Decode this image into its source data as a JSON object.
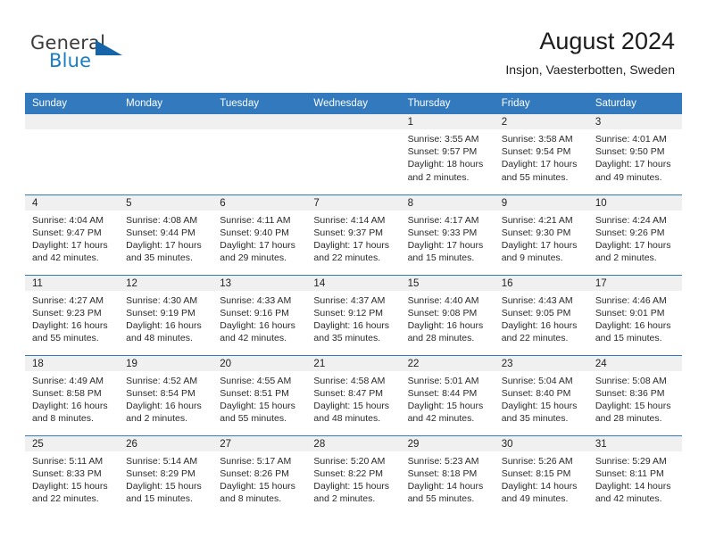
{
  "brand": {
    "name_part1": "General",
    "name_part2": "Blue",
    "triangle_color": "#1565a8",
    "blue_color": "#1a7dc4"
  },
  "header": {
    "title": "August 2024",
    "subtitle": "Insjon, Vaesterbotten, Sweden"
  },
  "theme": {
    "header_blue": "#3279bd",
    "band_gray": "#f0f0f0",
    "text": "#222222"
  },
  "weekdays": [
    "Sunday",
    "Monday",
    "Tuesday",
    "Wednesday",
    "Thursday",
    "Friday",
    "Saturday"
  ],
  "labels": {
    "sunrise_prefix": "Sunrise:",
    "sunset_prefix": "Sunset:",
    "daylight_prefix": "Daylight:"
  },
  "weeks": [
    [
      {
        "day": "",
        "sunrise": "",
        "sunset": "",
        "daylight": ""
      },
      {
        "day": "",
        "sunrise": "",
        "sunset": "",
        "daylight": ""
      },
      {
        "day": "",
        "sunrise": "",
        "sunset": "",
        "daylight": ""
      },
      {
        "day": "",
        "sunrise": "",
        "sunset": "",
        "daylight": ""
      },
      {
        "day": "1",
        "sunrise": "Sunrise: 3:55 AM",
        "sunset": "Sunset: 9:57 PM",
        "daylight": "Daylight: 18 hours and 2 minutes."
      },
      {
        "day": "2",
        "sunrise": "Sunrise: 3:58 AM",
        "sunset": "Sunset: 9:54 PM",
        "daylight": "Daylight: 17 hours and 55 minutes."
      },
      {
        "day": "3",
        "sunrise": "Sunrise: 4:01 AM",
        "sunset": "Sunset: 9:50 PM",
        "daylight": "Daylight: 17 hours and 49 minutes."
      }
    ],
    [
      {
        "day": "4",
        "sunrise": "Sunrise: 4:04 AM",
        "sunset": "Sunset: 9:47 PM",
        "daylight": "Daylight: 17 hours and 42 minutes."
      },
      {
        "day": "5",
        "sunrise": "Sunrise: 4:08 AM",
        "sunset": "Sunset: 9:44 PM",
        "daylight": "Daylight: 17 hours and 35 minutes."
      },
      {
        "day": "6",
        "sunrise": "Sunrise: 4:11 AM",
        "sunset": "Sunset: 9:40 PM",
        "daylight": "Daylight: 17 hours and 29 minutes."
      },
      {
        "day": "7",
        "sunrise": "Sunrise: 4:14 AM",
        "sunset": "Sunset: 9:37 PM",
        "daylight": "Daylight: 17 hours and 22 minutes."
      },
      {
        "day": "8",
        "sunrise": "Sunrise: 4:17 AM",
        "sunset": "Sunset: 9:33 PM",
        "daylight": "Daylight: 17 hours and 15 minutes."
      },
      {
        "day": "9",
        "sunrise": "Sunrise: 4:21 AM",
        "sunset": "Sunset: 9:30 PM",
        "daylight": "Daylight: 17 hours and 9 minutes."
      },
      {
        "day": "10",
        "sunrise": "Sunrise: 4:24 AM",
        "sunset": "Sunset: 9:26 PM",
        "daylight": "Daylight: 17 hours and 2 minutes."
      }
    ],
    [
      {
        "day": "11",
        "sunrise": "Sunrise: 4:27 AM",
        "sunset": "Sunset: 9:23 PM",
        "daylight": "Daylight: 16 hours and 55 minutes."
      },
      {
        "day": "12",
        "sunrise": "Sunrise: 4:30 AM",
        "sunset": "Sunset: 9:19 PM",
        "daylight": "Daylight: 16 hours and 48 minutes."
      },
      {
        "day": "13",
        "sunrise": "Sunrise: 4:33 AM",
        "sunset": "Sunset: 9:16 PM",
        "daylight": "Daylight: 16 hours and 42 minutes."
      },
      {
        "day": "14",
        "sunrise": "Sunrise: 4:37 AM",
        "sunset": "Sunset: 9:12 PM",
        "daylight": "Daylight: 16 hours and 35 minutes."
      },
      {
        "day": "15",
        "sunrise": "Sunrise: 4:40 AM",
        "sunset": "Sunset: 9:08 PM",
        "daylight": "Daylight: 16 hours and 28 minutes."
      },
      {
        "day": "16",
        "sunrise": "Sunrise: 4:43 AM",
        "sunset": "Sunset: 9:05 PM",
        "daylight": "Daylight: 16 hours and 22 minutes."
      },
      {
        "day": "17",
        "sunrise": "Sunrise: 4:46 AM",
        "sunset": "Sunset: 9:01 PM",
        "daylight": "Daylight: 16 hours and 15 minutes."
      }
    ],
    [
      {
        "day": "18",
        "sunrise": "Sunrise: 4:49 AM",
        "sunset": "Sunset: 8:58 PM",
        "daylight": "Daylight: 16 hours and 8 minutes."
      },
      {
        "day": "19",
        "sunrise": "Sunrise: 4:52 AM",
        "sunset": "Sunset: 8:54 PM",
        "daylight": "Daylight: 16 hours and 2 minutes."
      },
      {
        "day": "20",
        "sunrise": "Sunrise: 4:55 AM",
        "sunset": "Sunset: 8:51 PM",
        "daylight": "Daylight: 15 hours and 55 minutes."
      },
      {
        "day": "21",
        "sunrise": "Sunrise: 4:58 AM",
        "sunset": "Sunset: 8:47 PM",
        "daylight": "Daylight: 15 hours and 48 minutes."
      },
      {
        "day": "22",
        "sunrise": "Sunrise: 5:01 AM",
        "sunset": "Sunset: 8:44 PM",
        "daylight": "Daylight: 15 hours and 42 minutes."
      },
      {
        "day": "23",
        "sunrise": "Sunrise: 5:04 AM",
        "sunset": "Sunset: 8:40 PM",
        "daylight": "Daylight: 15 hours and 35 minutes."
      },
      {
        "day": "24",
        "sunrise": "Sunrise: 5:08 AM",
        "sunset": "Sunset: 8:36 PM",
        "daylight": "Daylight: 15 hours and 28 minutes."
      }
    ],
    [
      {
        "day": "25",
        "sunrise": "Sunrise: 5:11 AM",
        "sunset": "Sunset: 8:33 PM",
        "daylight": "Daylight: 15 hours and 22 minutes."
      },
      {
        "day": "26",
        "sunrise": "Sunrise: 5:14 AM",
        "sunset": "Sunset: 8:29 PM",
        "daylight": "Daylight: 15 hours and 15 minutes."
      },
      {
        "day": "27",
        "sunrise": "Sunrise: 5:17 AM",
        "sunset": "Sunset: 8:26 PM",
        "daylight": "Daylight: 15 hours and 8 minutes."
      },
      {
        "day": "28",
        "sunrise": "Sunrise: 5:20 AM",
        "sunset": "Sunset: 8:22 PM",
        "daylight": "Daylight: 15 hours and 2 minutes."
      },
      {
        "day": "29",
        "sunrise": "Sunrise: 5:23 AM",
        "sunset": "Sunset: 8:18 PM",
        "daylight": "Daylight: 14 hours and 55 minutes."
      },
      {
        "day": "30",
        "sunrise": "Sunrise: 5:26 AM",
        "sunset": "Sunset: 8:15 PM",
        "daylight": "Daylight: 14 hours and 49 minutes."
      },
      {
        "day": "31",
        "sunrise": "Sunrise: 5:29 AM",
        "sunset": "Sunset: 8:11 PM",
        "daylight": "Daylight: 14 hours and 42 minutes."
      }
    ]
  ]
}
